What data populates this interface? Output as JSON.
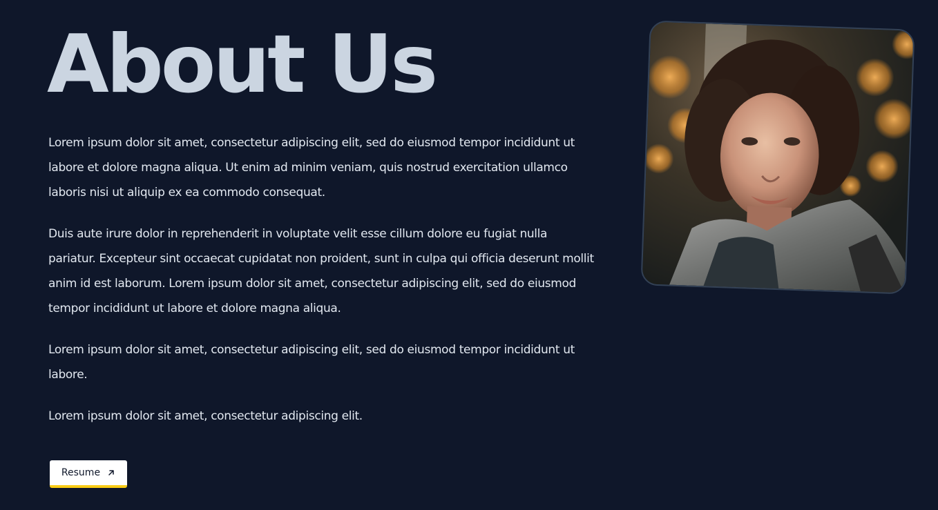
{
  "about": {
    "title": "About Us",
    "paragraphs": [
      "Lorem ipsum dolor sit amet, consectetur adipiscing elit, sed do eiusmod tempor incididunt ut labore et dolore magna aliqua. Ut enim ad minim veniam, quis nostrud exercitation ullamco laboris nisi ut aliquip ex ea commodo consequat.",
      "Duis aute irure dolor in reprehenderit in voluptate velit esse cillum dolore eu fugiat nulla pariatur. Excepteur sint occaecat cupidatat non proident, sunt in culpa qui officia deserunt mollit anim id est laborum. Lorem ipsum dolor sit amet, consectetur adipiscing elit, sed do eiusmod tempor incididunt ut labore et dolore magna aliqua.",
      "Lorem ipsum dolor sit amet, consectetur adipiscing elit, sed do eiusmod tempor incididunt ut labore.",
      "Lorem ipsum dolor sit amet, consectetur adipiscing elit."
    ],
    "resume_label": "Resume",
    "resume_icon": "arrow-up-right-icon"
  },
  "colors": {
    "background": "#0f172a",
    "title": "#cbd5e1",
    "text": "#e2e8f0",
    "button_bg": "#ffffff",
    "button_accent": "#facc15"
  }
}
